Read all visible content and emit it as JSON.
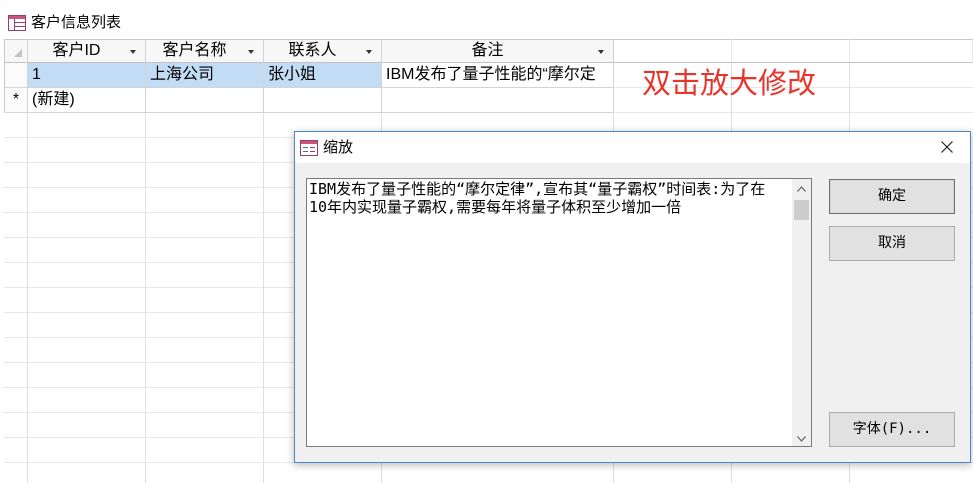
{
  "document_tab": {
    "title": "客户信息列表",
    "icon": "table-icon"
  },
  "datasheet": {
    "columns": [
      {
        "label": "客户ID",
        "icon": "dropdown-arrow-icon"
      },
      {
        "label": "客户名称",
        "icon": "dropdown-arrow-icon"
      },
      {
        "label": "联系人",
        "icon": "dropdown-arrow-icon"
      },
      {
        "label": "备注",
        "icon": "dropdown-arrow-icon"
      }
    ],
    "rows": [
      {
        "cells": [
          "1",
          "上海公司",
          "张小姐",
          "IBM发布了量子性能的“摩尔定"
        ]
      },
      {
        "selector": "*",
        "cells": [
          "(新建)"
        ]
      }
    ]
  },
  "annotation": {
    "text": "双击放大修改",
    "color": "#e8352c"
  },
  "zoom_dialog": {
    "title": "缩放",
    "icon": "form-icon",
    "close_icon": "close-icon",
    "text_lines": [
      "IBM发布了量子性能的“摩尔定律”,宣布其“量子霸权”时间表:为了在",
      "10年内实现量子霸权,需要每年将量子体积至少增加一倍"
    ],
    "buttons": {
      "ok": "确定",
      "cancel": "取消",
      "font": "字体(F)..."
    }
  },
  "colors": {
    "selection": "#c3dcf5",
    "dialog_border": "#4a88c7",
    "button_face": "#e1e1e1"
  }
}
